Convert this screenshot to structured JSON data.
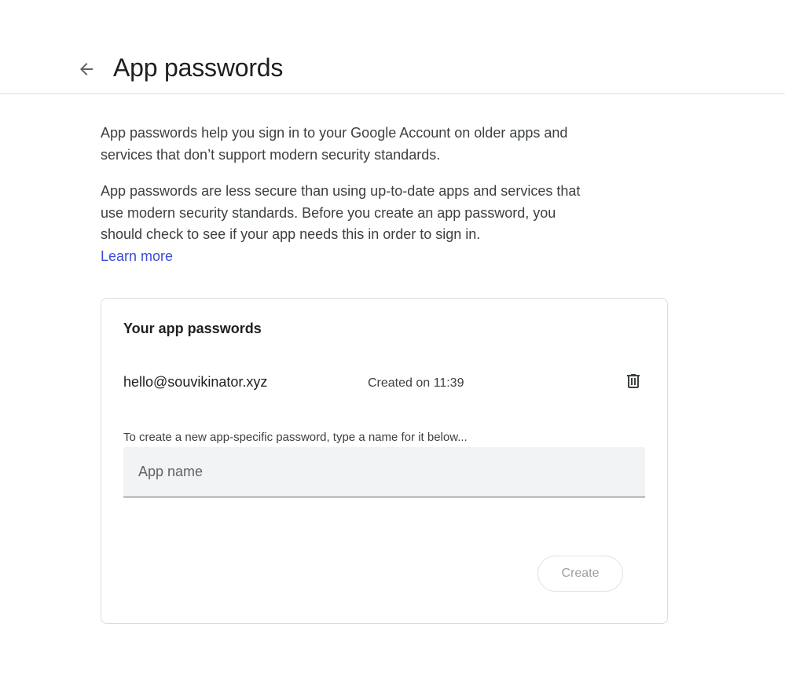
{
  "header": {
    "back_icon": "arrow-back-icon",
    "title": "App passwords"
  },
  "description": {
    "paragraph1": "App passwords help you sign in to your Google Account on older apps and services that don’t support modern security standards.",
    "paragraph2": "App passwords are less secure than using up-to-date apps and services that use modern security standards. Before you create an app password, you should check to see if your app needs this in order to sign in.",
    "learn_more": "Learn more"
  },
  "card": {
    "title": "Your app passwords",
    "passwords": [
      {
        "name": "hello@souvikinator.xyz",
        "created": "Created on 11:39",
        "delete_icon": "trash-icon"
      }
    ],
    "hint": "To create a new app-specific password, type a name for it below...",
    "input_value": "",
    "input_placeholder": "App name",
    "create_label": "Create",
    "create_enabled": false
  },
  "colors": {
    "link": "#3c4cd7",
    "text": "#1f1f1f",
    "border": "#dadce0",
    "input_bg": "#f1f3f4",
    "disabled_text": "#9aa0a6"
  }
}
